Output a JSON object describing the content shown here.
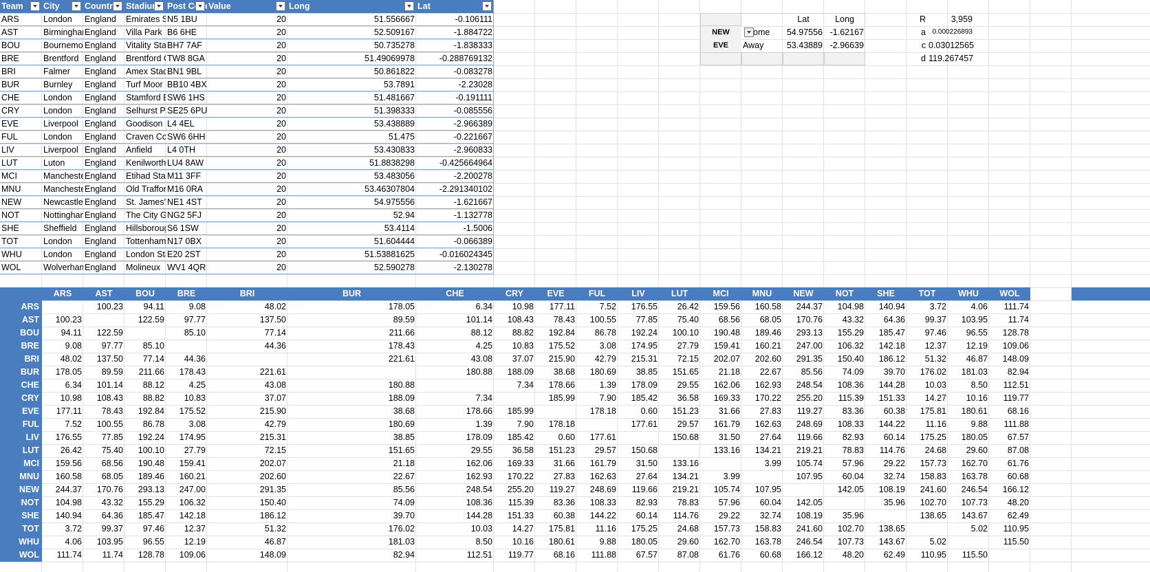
{
  "team_table": {
    "headers": [
      "Team",
      "City",
      "Country",
      "Stadium",
      "Post Code",
      "Value",
      "Long",
      "Lat"
    ],
    "rows": [
      [
        "ARS",
        "London",
        "England",
        "Emirates Stadium",
        "N5 1BU",
        "20",
        "51.556667",
        "-0.106111"
      ],
      [
        "AST",
        "Birmingham",
        "England",
        "Villa Park",
        "B6 6HE",
        "20",
        "52.509167",
        "-1.884722"
      ],
      [
        "BOU",
        "Bournemouth",
        "England",
        "Vitality Stadium",
        "BH7 7AF",
        "20",
        "50.735278",
        "-1.838333"
      ],
      [
        "BRE",
        "Brentford",
        "England",
        "Brentford Community Stadium",
        "TW8 8GA",
        "20",
        "51.49069978",
        "-0.288769132"
      ],
      [
        "BRI",
        "Falmer",
        "England",
        "Amex Stadium",
        "BN1 9BL",
        "20",
        "50.861822",
        "-0.083278"
      ],
      [
        "BUR",
        "Burnley",
        "England",
        "Turf Moor",
        "BB10 4BX",
        "20",
        "53.7891",
        "-2.23028"
      ],
      [
        "CHE",
        "London",
        "England",
        "Stamford Bridge",
        "SW6 1HS",
        "20",
        "51.481667",
        "-0.191111"
      ],
      [
        "CRY",
        "London",
        "England",
        "Selhurst Park",
        "SE25 6PU",
        "20",
        "51.398333",
        "-0.085556"
      ],
      [
        "EVE",
        "Liverpool",
        "England",
        "Goodison Park",
        "L4 4EL",
        "20",
        "53.438889",
        "-2.966389"
      ],
      [
        "FUL",
        "London",
        "England",
        "Craven Cottage",
        "SW6 6HH",
        "20",
        "51.475",
        "-0.221667"
      ],
      [
        "LIV",
        "Liverpool",
        "England",
        "Anfield",
        "L4 0TH",
        "20",
        "53.430833",
        "-2.960833"
      ],
      [
        "LUT",
        "Luton",
        "England",
        "Kenilworth Road",
        "LU4 8AW",
        "20",
        "51.8838298",
        "-0.425664964"
      ],
      [
        "MCI",
        "Manchester",
        "England",
        "Etihad Stadium",
        "M11 3FF",
        "20",
        "53.483056",
        "-2.200278"
      ],
      [
        "MNU",
        "Manchester",
        "England",
        "Old Trafford",
        "M16 0RA",
        "20",
        "53.46307804",
        "-2.291340102"
      ],
      [
        "NEW",
        "Newcastle",
        "England",
        "St. James' Park",
        "NE1 4ST",
        "20",
        "54.975556",
        "-1.621667"
      ],
      [
        "NOT",
        "Nottingham",
        "England",
        "The City Ground",
        "NG2 5FJ",
        "20",
        "52.94",
        "-1.132778"
      ],
      [
        "SHE",
        "Sheffield",
        "England",
        "Hillsborough",
        "S6 1SW",
        "20",
        "53.4114",
        "-1.5006"
      ],
      [
        "TOT",
        "London",
        "England",
        "Tottenham Hotspur Stadium",
        "N17 0BX",
        "20",
        "51.604444",
        "-0.066389"
      ],
      [
        "WHU",
        "London",
        "England",
        "London Stadium",
        "E20 2ST",
        "20",
        "51.53881625",
        "-0.016024345"
      ],
      [
        "WOL",
        "Wolverhampton",
        "England",
        "Molineux",
        "WV1 4QR",
        "20",
        "52.590278",
        "-2.130278"
      ]
    ]
  },
  "calc_panel": {
    "lat_header": "Lat",
    "long_header": "Long",
    "home_team": "NEW",
    "home_label": "Home",
    "home_lat": "54.97556",
    "home_long": "-1.62167",
    "away_team": "EVE",
    "away_label": "Away",
    "away_lat": "53.43889",
    "away_long": "-2.96639",
    "r_label": "R",
    "r_value": "3,959",
    "a_label": "a",
    "a_value": "0.000226893",
    "c_label": "c",
    "c_value": "0.03012565",
    "d_label": "d",
    "d_value": "119.267457"
  },
  "matrix": {
    "teams": [
      "ARS",
      "AST",
      "BOU",
      "BRE",
      "BRI",
      "BUR",
      "CHE",
      "CRY",
      "EVE",
      "FUL",
      "LIV",
      "LUT",
      "MCI",
      "MNU",
      "NEW",
      "NOT",
      "SHE",
      "TOT",
      "WHU",
      "WOL"
    ],
    "rows": [
      [
        "",
        "100.23",
        "94.11",
        "9.08",
        "48.02",
        "178.05",
        "6.34",
        "10.98",
        "177.11",
        "7.52",
        "176.55",
        "26.42",
        "159.56",
        "160.58",
        "244.37",
        "104.98",
        "140.94",
        "3.72",
        "4.06",
        "111.74"
      ],
      [
        "100.23",
        "",
        "122.59",
        "97.77",
        "137.50",
        "89.59",
        "101.14",
        "108.43",
        "78.43",
        "100.55",
        "77.85",
        "75.40",
        "68.56",
        "68.05",
        "170.76",
        "43.32",
        "64.36",
        "99.37",
        "103.95",
        "11.74"
      ],
      [
        "94.11",
        "122.59",
        "",
        "85.10",
        "77.14",
        "211.66",
        "88.12",
        "88.82",
        "192.84",
        "86.78",
        "192.24",
        "100.10",
        "190.48",
        "189.46",
        "293.13",
        "155.29",
        "185.47",
        "97.46",
        "96.55",
        "128.78"
      ],
      [
        "9.08",
        "97.77",
        "85.10",
        "",
        "44.36",
        "178.43",
        "4.25",
        "10.83",
        "175.52",
        "3.08",
        "174.95",
        "27.79",
        "159.41",
        "160.21",
        "247.00",
        "106.32",
        "142.18",
        "12.37",
        "12.19",
        "109.06"
      ],
      [
        "48.02",
        "137.50",
        "77.14",
        "44.36",
        "",
        "221.61",
        "43.08",
        "37.07",
        "215.90",
        "42.79",
        "215.31",
        "72.15",
        "202.07",
        "202.60",
        "291.35",
        "150.40",
        "186.12",
        "51.32",
        "46.87",
        "148.09"
      ],
      [
        "178.05",
        "89.59",
        "211.66",
        "178.43",
        "221.61",
        "",
        "180.88",
        "188.09",
        "38.68",
        "180.69",
        "38.85",
        "151.65",
        "21.18",
        "22.67",
        "85.56",
        "74.09",
        "39.70",
        "176.02",
        "181.03",
        "82.94"
      ],
      [
        "6.34",
        "101.14",
        "88.12",
        "4.25",
        "43.08",
        "180.88",
        "",
        "7.34",
        "178.66",
        "1.39",
        "178.09",
        "29.55",
        "162.06",
        "162.93",
        "248.54",
        "108.36",
        "144.28",
        "10.03",
        "8.50",
        "112.51"
      ],
      [
        "10.98",
        "108.43",
        "88.82",
        "10.83",
        "37.07",
        "188.09",
        "7.34",
        "",
        "185.99",
        "7.90",
        "185.42",
        "36.58",
        "169.33",
        "170.22",
        "255.20",
        "115.39",
        "151.33",
        "14.27",
        "10.16",
        "119.77"
      ],
      [
        "177.11",
        "78.43",
        "192.84",
        "175.52",
        "215.90",
        "38.68",
        "178.66",
        "185.99",
        "",
        "178.18",
        "0.60",
        "151.23",
        "31.66",
        "27.83",
        "119.27",
        "83.36",
        "60.38",
        "175.81",
        "180.61",
        "68.16"
      ],
      [
        "7.52",
        "100.55",
        "86.78",
        "3.08",
        "42.79",
        "180.69",
        "1.39",
        "7.90",
        "178.18",
        "",
        "177.61",
        "29.57",
        "161.79",
        "162.63",
        "248.69",
        "108.33",
        "144.22",
        "11.16",
        "9.88",
        "111.88"
      ],
      [
        "176.55",
        "77.85",
        "192.24",
        "174.95",
        "215.31",
        "38.85",
        "178.09",
        "185.42",
        "0.60",
        "177.61",
        "",
        "150.68",
        "31.50",
        "27.64",
        "119.66",
        "82.93",
        "60.14",
        "175.25",
        "180.05",
        "67.57"
      ],
      [
        "26.42",
        "75.40",
        "100.10",
        "27.79",
        "72.15",
        "151.65",
        "29.55",
        "36.58",
        "151.23",
        "29.57",
        "150.68",
        "",
        "133.16",
        "134.21",
        "219.21",
        "78.83",
        "114.76",
        "24.68",
        "29.60",
        "87.08"
      ],
      [
        "159.56",
        "68.56",
        "190.48",
        "159.41",
        "202.07",
        "21.18",
        "162.06",
        "169.33",
        "31.66",
        "161.79",
        "31.50",
        "133.16",
        "",
        "3.99",
        "105.74",
        "57.96",
        "29.22",
        "157.73",
        "162.70",
        "61.76"
      ],
      [
        "160.58",
        "68.05",
        "189.46",
        "160.21",
        "202.60",
        "22.67",
        "162.93",
        "170.22",
        "27.83",
        "162.63",
        "27.64",
        "134.21",
        "3.99",
        "",
        "107.95",
        "60.04",
        "32.74",
        "158.83",
        "163.78",
        "60.68"
      ],
      [
        "244.37",
        "170.76",
        "293.13",
        "247.00",
        "291.35",
        "85.56",
        "248.54",
        "255.20",
        "119.27",
        "248.69",
        "119.66",
        "219.21",
        "105.74",
        "107.95",
        "",
        "142.05",
        "108.19",
        "241.60",
        "246.54",
        "166.12"
      ],
      [
        "104.98",
        "43.32",
        "155.29",
        "106.32",
        "150.40",
        "74.09",
        "108.36",
        "115.39",
        "83.36",
        "108.33",
        "82.93",
        "78.83",
        "57.96",
        "60.04",
        "142.05",
        "",
        "35.96",
        "102.70",
        "107.73",
        "48.20"
      ],
      [
        "140.94",
        "64.36",
        "185.47",
        "142.18",
        "186.12",
        "39.70",
        "144.28",
        "151.33",
        "60.38",
        "144.22",
        "60.14",
        "114.76",
        "29.22",
        "32.74",
        "108.19",
        "35.96",
        "",
        "138.65",
        "143.67",
        "62.49"
      ],
      [
        "3.72",
        "99.37",
        "97.46",
        "12.37",
        "51.32",
        "176.02",
        "10.03",
        "14.27",
        "175.81",
        "11.16",
        "175.25",
        "24.68",
        "157.73",
        "158.83",
        "241.60",
        "102.70",
        "138.65",
        "",
        "5.02",
        "110.95"
      ],
      [
        "4.06",
        "103.95",
        "96.55",
        "12.19",
        "46.87",
        "181.03",
        "8.50",
        "10.16",
        "180.61",
        "9.88",
        "180.05",
        "29.60",
        "162.70",
        "163.78",
        "246.54",
        "107.73",
        "143.67",
        "5.02",
        "",
        "115.50"
      ],
      [
        "111.74",
        "11.74",
        "128.78",
        "109.06",
        "148.09",
        "82.94",
        "112.51",
        "119.77",
        "68.16",
        "111.88",
        "67.57",
        "87.08",
        "61.76",
        "60.68",
        "166.12",
        "48.20",
        "62.49",
        "110.95",
        "115.50",
        ""
      ]
    ]
  }
}
